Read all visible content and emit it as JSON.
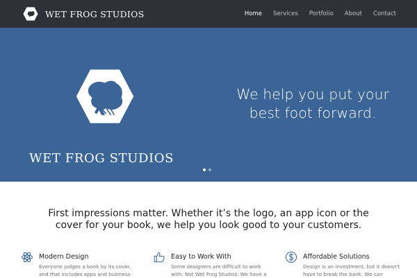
{
  "brand": {
    "name": "WET FROG STUDIOS"
  },
  "nav": {
    "items": [
      {
        "label": "Home",
        "active": true
      },
      {
        "label": "Services",
        "active": false
      },
      {
        "label": "Portfolio",
        "active": false
      },
      {
        "label": "About",
        "active": false
      },
      {
        "label": "Contact",
        "active": false
      }
    ]
  },
  "hero": {
    "logo_text": "WET FROG STUDIOS",
    "tagline_line1": "We help you put your",
    "tagline_line2": "best foot forward.",
    "slides": 2,
    "active_slide": 1
  },
  "intro": {
    "line1": "First impressions matter. Whether it’s the logo, an app icon or the",
    "line2": "cover for your book, we help you look good to your customers."
  },
  "features": [
    {
      "icon": "atom-icon",
      "title": "Modern Design",
      "desc_line1": "Everyone judges a book by its cover,",
      "desc_line2": "and that includes apps and business"
    },
    {
      "icon": "thumbs-up-icon",
      "title": "Easy to Work With",
      "desc_line1": "Some designers are difficult to work",
      "desc_line2": "with. Not Wet Frog Studios. We have a"
    },
    {
      "icon": "dollar-icon",
      "title": "Affordable Solutions",
      "desc_line1": "Design is an investment, but it doesn't",
      "desc_line2": "have to break the bank. We can"
    }
  ],
  "colors": {
    "navbar": "#2e3238",
    "hero": "#3a6596",
    "accent": "#3a6596",
    "text": "#222222"
  }
}
